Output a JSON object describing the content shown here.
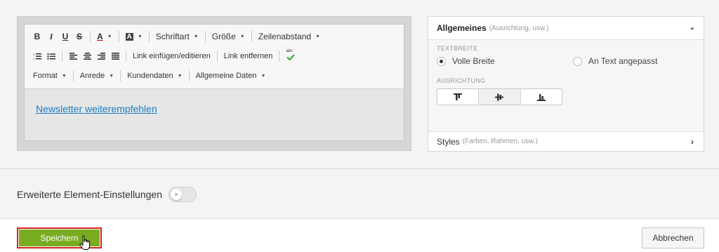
{
  "editor": {
    "toolbar": {
      "bold": "B",
      "italic": "I",
      "underline": "U",
      "strike": "S",
      "font_color": "A",
      "bg_color": "A",
      "font_family": "Schriftart",
      "font_size": "Größe",
      "line_height": "Zeilenabstand",
      "link_insert": "Link einfügen/editieren",
      "link_remove": "Link entfernen",
      "spellcheck": "abc",
      "format": "Format",
      "salutation": "Anrede",
      "customer_data": "Kundendaten",
      "general_data": "Allgemeine Daten"
    },
    "content_link": "Newsletter weiterempfehlen"
  },
  "panel": {
    "title": "Allgemeines",
    "title_sub": "(Ausrichtung, usw.)",
    "textwidth_label": "TEXTBREITE",
    "radio_full": "Volle Breite",
    "radio_fit": "An Text angepasst",
    "align_label": "AUSRICHTUNG",
    "styles_title": "Styles",
    "styles_sub": "(Farben, Rahmen, usw.)"
  },
  "advanced": {
    "label": "Erweiterte Element-Einstellungen",
    "enabled": false
  },
  "footer": {
    "save": "Speichern",
    "cancel": "Abbrechen"
  },
  "colors": {
    "save_green": "#7aac21",
    "save_border": "#d8231e",
    "link_blue": "#1b7ec2"
  }
}
